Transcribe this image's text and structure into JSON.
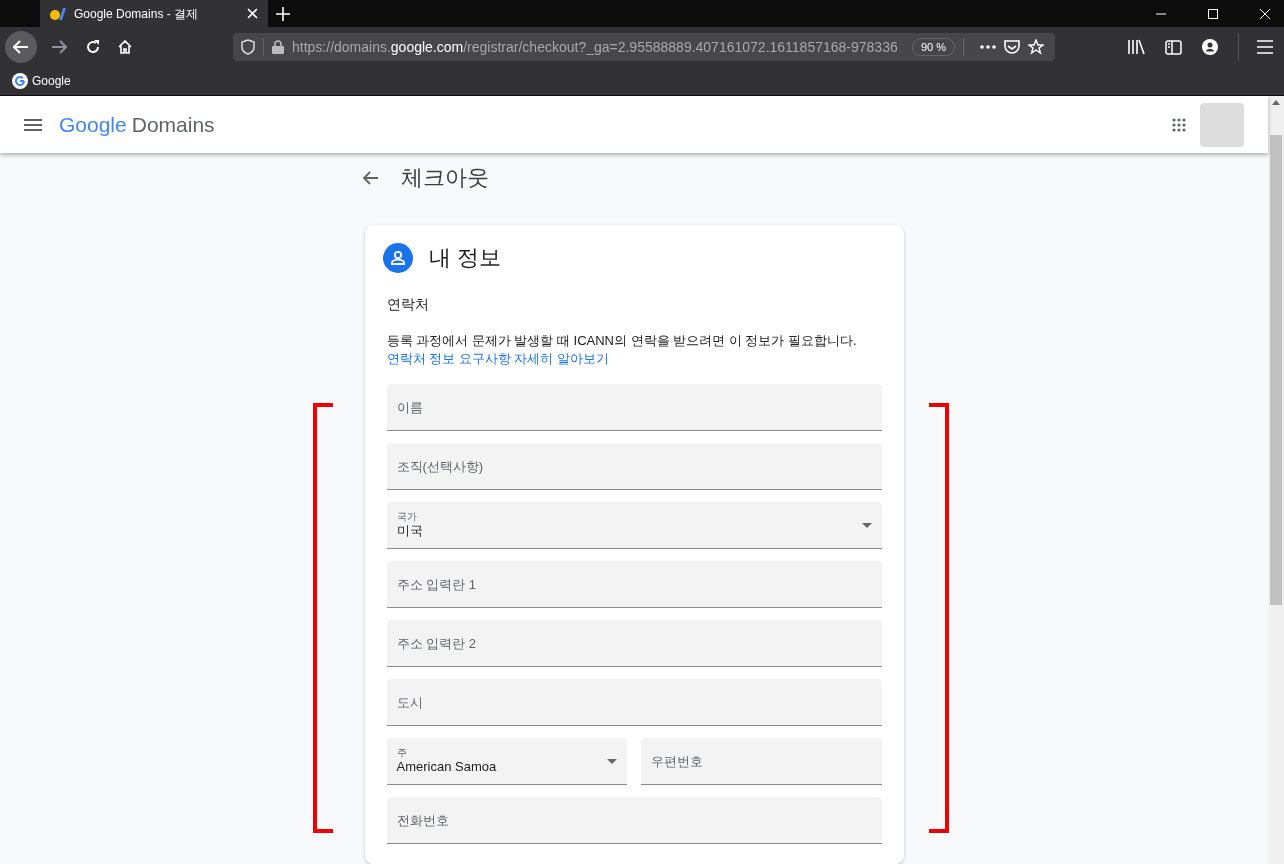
{
  "browser": {
    "tab": {
      "title": "Google Domains - 결제",
      "selected": true
    },
    "url": {
      "before": "https://domains.",
      "host": "google.com",
      "after": "/registrar/checkout?_ga=2.95588889.407161072.1611857168-978336"
    },
    "zoom": "90 %",
    "bookmarks": [
      {
        "label": "Google"
      }
    ]
  },
  "header": {
    "logo": "Google",
    "product": "Domains"
  },
  "page": {
    "title": "체크아웃"
  },
  "card": {
    "title": "내 정보",
    "section": "연락처",
    "description": "등록 과정에서 문제가 발생할 때 ICANN의 연락을 받으려면 이 정보가 필요합니다.",
    "link": "연락처 정보 요구사항 자세히 알아보기",
    "rows": [
      [
        {
          "kind": "text",
          "placeholder": "이름"
        }
      ],
      [
        {
          "kind": "text",
          "placeholder": "조직(선택사항)"
        }
      ],
      [
        {
          "kind": "select",
          "label": "국가",
          "value": "미국"
        }
      ],
      [
        {
          "kind": "text",
          "placeholder": "주소 입력란 1"
        }
      ],
      [
        {
          "kind": "text",
          "placeholder": "주소 입력란 2"
        }
      ],
      [
        {
          "kind": "text",
          "placeholder": "도시"
        }
      ],
      [
        {
          "kind": "select",
          "label": "주",
          "value": "American Samoa"
        },
        {
          "kind": "text",
          "placeholder": "우편번호"
        }
      ],
      [
        {
          "kind": "text",
          "placeholder": "전화번호"
        }
      ]
    ]
  }
}
